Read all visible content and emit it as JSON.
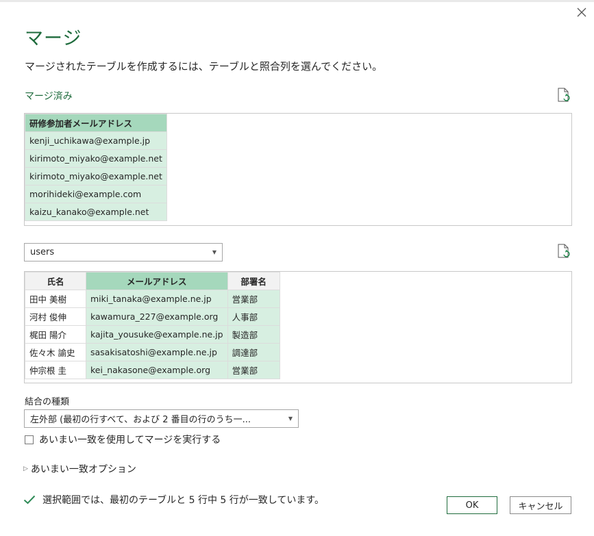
{
  "dialog": {
    "title": "マージ",
    "description": "マージされたテーブルを作成するには、テーブルと照合列を選んでください。",
    "merged_label": "マージ済み"
  },
  "merged_table": {
    "header": "研修参加者メールアドレス",
    "rows": [
      "kenji_uchikawa@example.jp",
      "kirimoto_miyako@example.net",
      "kirimoto_miyako@example.net",
      "morihideki@example.com",
      "kaizu_kanako@example.net"
    ]
  },
  "second_table": {
    "selected_table": "users",
    "columns": [
      "氏名",
      "メールアドレス",
      "部署名"
    ],
    "selected_column_index": 1,
    "rows": [
      [
        "田中 美樹",
        "miki_tanaka@example.ne.jp",
        "営業部"
      ],
      [
        "河村 俊伸",
        "kawamura_227@example.org",
        "人事部"
      ],
      [
        "梶田 陽介",
        "kajita_yousuke@example.ne.jp",
        "製造部"
      ],
      [
        "佐々木 諭史",
        "sasakisatoshi@example.ne.jp",
        "調達部"
      ],
      [
        "仲宗根 圭",
        "kei_nakasone@example.org",
        "営業部"
      ]
    ]
  },
  "join": {
    "label": "結合の種類",
    "selected": "左外部 (最初の行すべて、および 2 番目の行のうち一..."
  },
  "fuzzy": {
    "checkbox_label": "あいまい一致を使用してマージを実行する",
    "checked": false,
    "options_label": "あいまい一致オプション"
  },
  "status": {
    "message": "選択範囲では、最初のテーブルと 5 行中 5 行が一致しています。"
  },
  "buttons": {
    "ok": "OK",
    "cancel": "キャンセル"
  },
  "icons": {
    "close": "close-icon",
    "refresh": "refresh-document-icon",
    "checkmark": "checkmark-icon",
    "caret": "chevron-down-icon",
    "expand": "expand-triangle-icon"
  },
  "colors": {
    "accent": "#1e6b3c",
    "selected_column": "#d7efe1",
    "selected_header": "#a5d8bc"
  }
}
